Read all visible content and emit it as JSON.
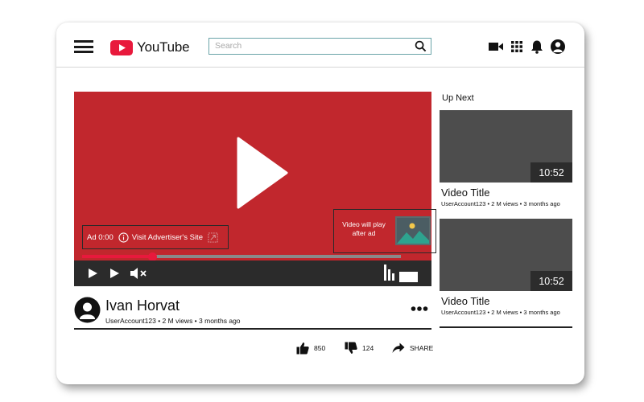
{
  "header": {
    "logo_text": "YouTube",
    "search_placeholder": "Search",
    "brand_color": "#e8193c"
  },
  "player": {
    "background_color": "#c1272d",
    "ad_label": "Ad 0:00",
    "ad_link": "Visit Advertiser's Site",
    "next_ad_text": "Video will play after ad",
    "progress_fraction": 0.22
  },
  "video_info": {
    "channel_name": "Ivan Horvat",
    "meta": "UserAccount123 • 2 M views • 3 months ago"
  },
  "actions": {
    "likes": "850",
    "dislikes": "124",
    "share_label": "SHARE"
  },
  "sidebar": {
    "title": "Up Next",
    "items": [
      {
        "duration": "10:52",
        "title": "Video Title",
        "meta": "UserAccount123 • 2 M views • 3 months ago"
      },
      {
        "duration": "10:52",
        "title": "Video Title",
        "meta": "UserAccount123 • 2 M views • 3 months ago"
      }
    ]
  },
  "icons": [
    "menu-icon",
    "youtube-logo-icon",
    "search-icon",
    "video-camera-icon",
    "apps-grid-icon",
    "bell-icon",
    "account-icon",
    "play-icon",
    "next-icon",
    "mute-icon",
    "info-icon",
    "external-link-icon",
    "bars-icon",
    "fullscreen-icon",
    "more-icon",
    "thumbs-up-icon",
    "thumbs-down-icon",
    "share-icon"
  ]
}
